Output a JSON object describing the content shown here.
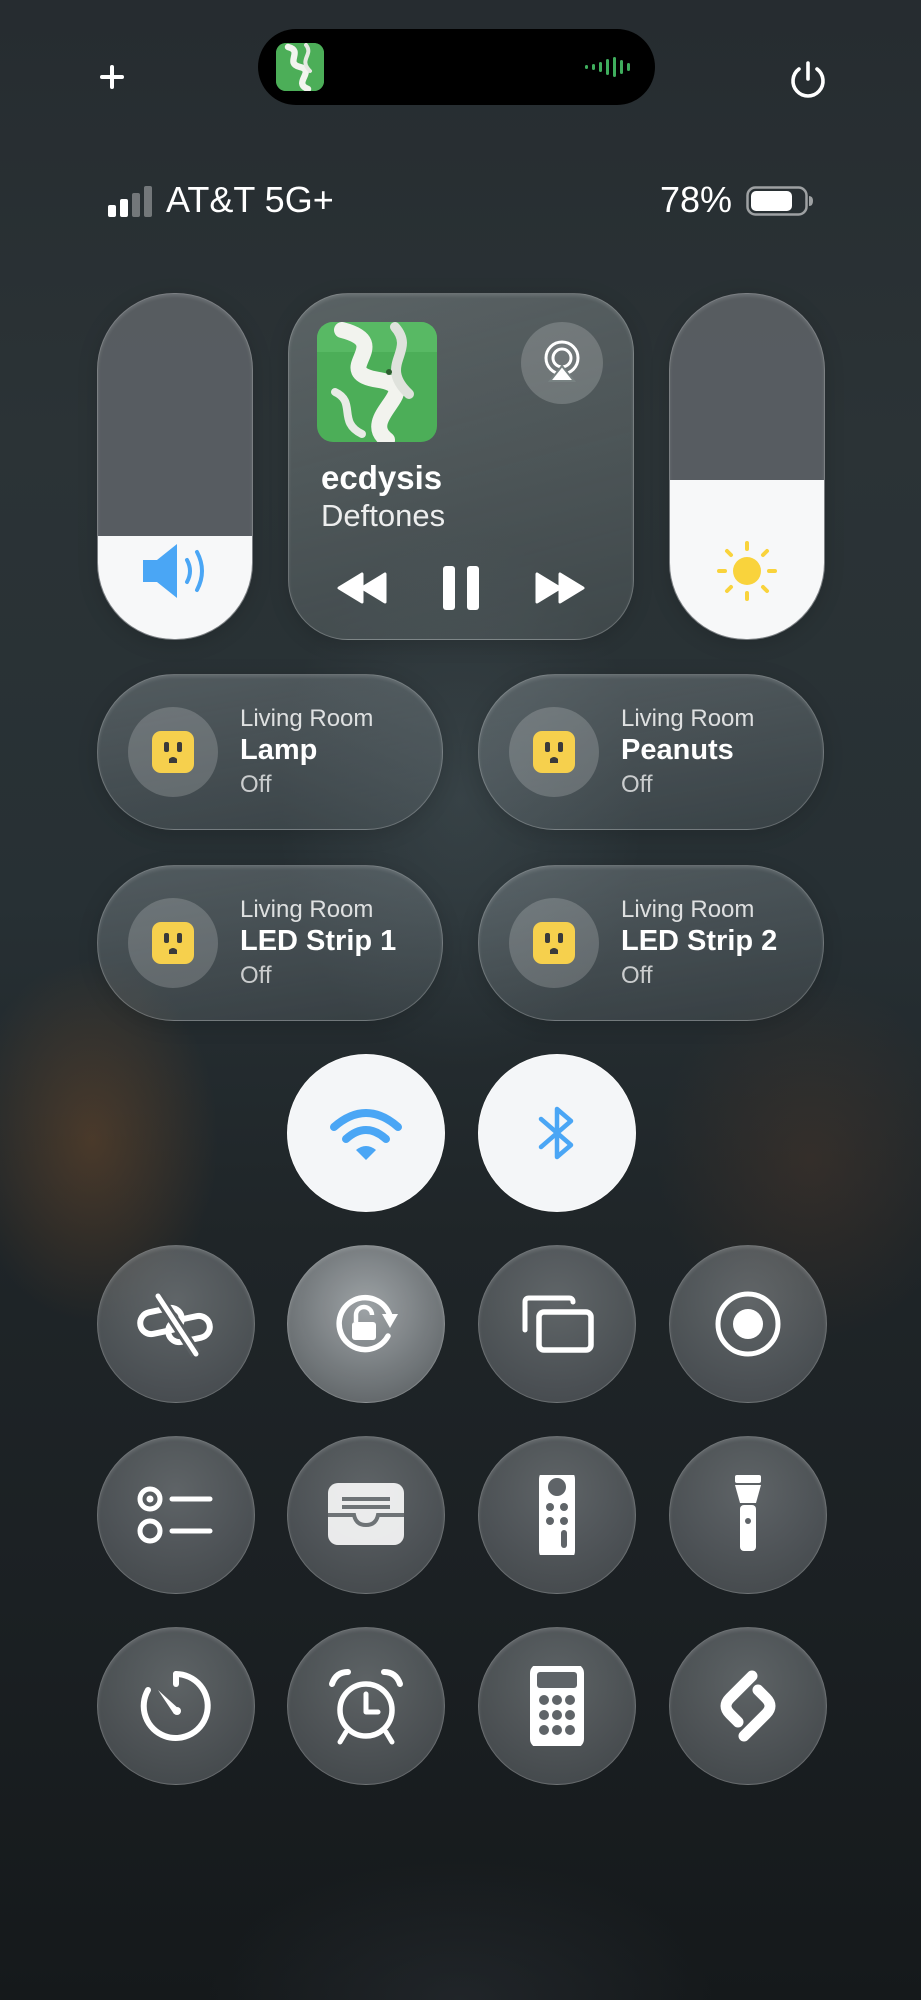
{
  "status_bar": {
    "carrier": "AT&T 5G+",
    "battery_percent": "78%",
    "battery_level": 0.78,
    "signal_bars": 2
  },
  "top_bar": {
    "add_icon": "plus-icon",
    "power_icon": "power-icon"
  },
  "volume": {
    "level": 0.3,
    "icon": "speaker-icon"
  },
  "brightness": {
    "level": 0.46,
    "icon": "sun-icon"
  },
  "now_playing": {
    "song": "ecdysis",
    "artist": "Deftones",
    "state": "playing",
    "controls": [
      "rewind-icon",
      "pause-icon",
      "fast-forward-icon"
    ],
    "airplay_icon": "airplay-icon"
  },
  "accessories": [
    {
      "room": "Living Room",
      "name": "Lamp",
      "state": "Off"
    },
    {
      "room": "Living Room",
      "name": "Peanuts",
      "state": "Off"
    },
    {
      "room": "Living Room",
      "name": "LED Strip 1",
      "state": "Off"
    },
    {
      "room": "Living Room",
      "name": "LED Strip 2",
      "state": "Off"
    }
  ],
  "connectivity": [
    {
      "icon": "wifi-icon",
      "on": true
    },
    {
      "icon": "bluetooth-icon",
      "on": true
    }
  ],
  "controls": [
    "link-off-icon",
    "rotation-lock-icon",
    "screen-mirroring-icon",
    "screen-record-icon",
    "reminders-icon",
    "wallet-icon",
    "remote-icon",
    "flashlight-icon",
    "timer-icon",
    "alarm-icon",
    "calculator-icon",
    "shazam-icon"
  ],
  "colors": {
    "accent_blue": "#4aa6f5",
    "outlet_yellow": "#f6d04d",
    "sun_yellow": "#f9d33c",
    "music_green": "#4cae58"
  }
}
